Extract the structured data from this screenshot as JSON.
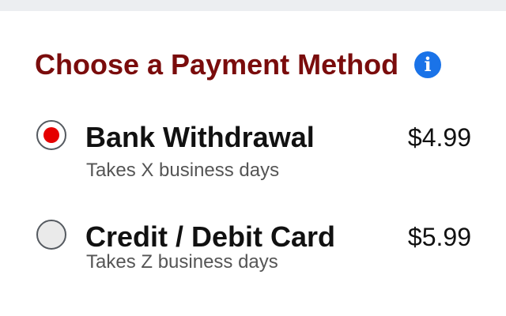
{
  "heading": "Choose a Payment Method",
  "info_icon": "info-icon",
  "options": [
    {
      "label": "Bank Withdrawal",
      "subtitle": "Takes X business days",
      "price": "$4.99",
      "selected": true
    },
    {
      "label": "Credit / Debit Card",
      "subtitle": "Takes Z business days",
      "price": "$5.99",
      "selected": false
    }
  ],
  "colors": {
    "heading": "#7a0c0c",
    "info_icon": "#1a73e8",
    "radio_selected_dot": "#e50000",
    "top_bar": "#eceef1"
  }
}
